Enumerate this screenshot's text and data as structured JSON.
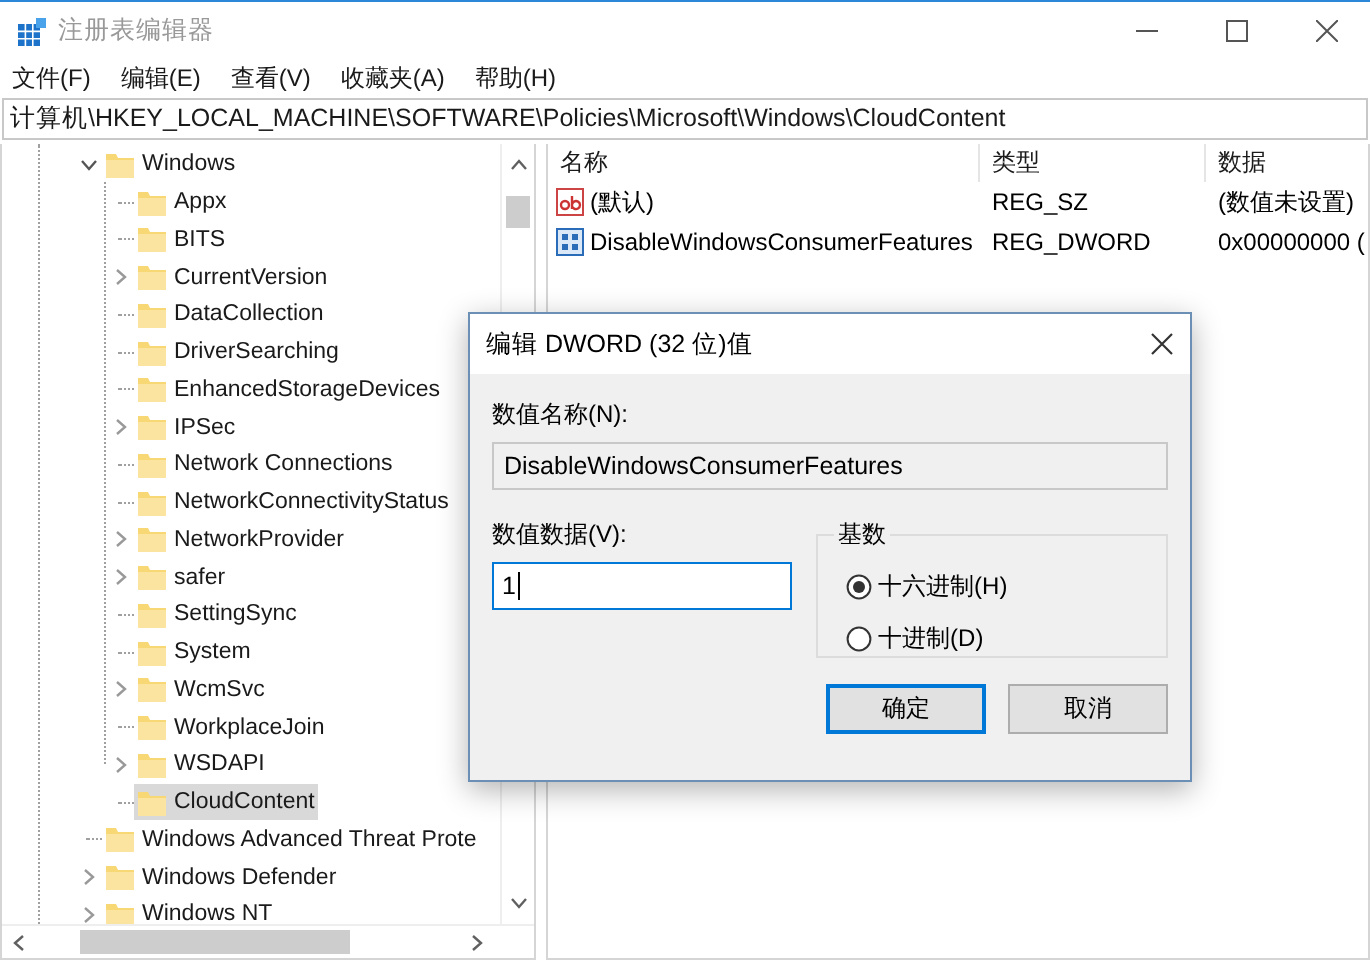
{
  "window": {
    "title": "注册表编辑器"
  },
  "menu": [
    {
      "label": "文件(F)"
    },
    {
      "label": "编辑(E)"
    },
    {
      "label": "查看(V)"
    },
    {
      "label": "收藏夹(A)"
    },
    {
      "label": "帮助(H)"
    }
  ],
  "address": "计算机\\HKEY_LOCAL_MACHINE\\SOFTWARE\\Policies\\Microsoft\\Windows\\CloudContent",
  "tree": [
    {
      "label": "Windows",
      "has_children": true,
      "expanded": true,
      "selected": false,
      "children": [
        {
          "label": "Appx",
          "has_children": false,
          "expanded": false,
          "selected": false
        },
        {
          "label": "BITS",
          "has_children": false,
          "expanded": false,
          "selected": false
        },
        {
          "label": "CurrentVersion",
          "has_children": true,
          "expanded": false,
          "selected": false
        },
        {
          "label": "DataCollection",
          "has_children": false,
          "expanded": false,
          "selected": false
        },
        {
          "label": "DriverSearching",
          "has_children": false,
          "expanded": false,
          "selected": false
        },
        {
          "label": "EnhancedStorageDevices",
          "has_children": false,
          "expanded": false,
          "selected": false
        },
        {
          "label": "IPSec",
          "has_children": true,
          "expanded": false,
          "selected": false
        },
        {
          "label": "Network Connections",
          "has_children": false,
          "expanded": false,
          "selected": false
        },
        {
          "label": "NetworkConnectivityStatus",
          "has_children": false,
          "expanded": false,
          "selected": false
        },
        {
          "label": "NetworkProvider",
          "has_children": true,
          "expanded": false,
          "selected": false
        },
        {
          "label": "safer",
          "has_children": true,
          "expanded": false,
          "selected": false
        },
        {
          "label": "SettingSync",
          "has_children": false,
          "expanded": false,
          "selected": false
        },
        {
          "label": "System",
          "has_children": false,
          "expanded": false,
          "selected": false
        },
        {
          "label": "WcmSvc",
          "has_children": true,
          "expanded": false,
          "selected": false
        },
        {
          "label": "WorkplaceJoin",
          "has_children": false,
          "expanded": false,
          "selected": false
        },
        {
          "label": "WSDAPI",
          "has_children": true,
          "expanded": false,
          "selected": false
        },
        {
          "label": "CloudContent",
          "has_children": false,
          "expanded": false,
          "selected": true
        }
      ]
    },
    {
      "label": "Windows Advanced Threat Prote",
      "has_children": false,
      "expanded": false,
      "selected": false
    },
    {
      "label": "Windows Defender",
      "has_children": true,
      "expanded": false,
      "selected": false
    },
    {
      "label": "Windows NT",
      "has_children": true,
      "expanded": false,
      "selected": false
    }
  ],
  "table": {
    "columns": [
      "名称",
      "类型",
      "数据"
    ],
    "rows": [
      {
        "kind": "string",
        "name": "(默认)",
        "type": "REG_SZ",
        "data": "(数值未设置)"
      },
      {
        "kind": "dword",
        "name": "DisableWindowsConsumerFeatures",
        "type": "REG_DWORD",
        "data": "0x00000000 ("
      }
    ]
  },
  "dialog": {
    "title": "编辑 DWORD (32 位)值",
    "name_label": "数值名称(N):",
    "name_value": "DisableWindowsConsumerFeatures",
    "data_label": "数值数据(V):",
    "data_value": "1",
    "base_label": "基数",
    "radios": [
      {
        "label": "十六进制(H)",
        "selected": true
      },
      {
        "label": "十进制(D)",
        "selected": false
      }
    ],
    "buttons": [
      {
        "label": "确定",
        "default": true
      },
      {
        "label": "取消",
        "default": false
      }
    ]
  }
}
